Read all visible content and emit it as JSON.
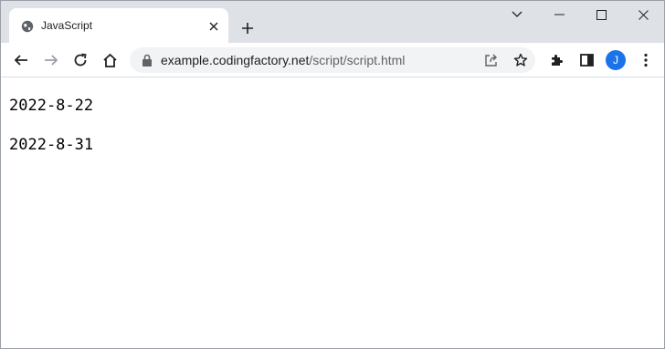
{
  "tab": {
    "title": "JavaScript"
  },
  "address_bar": {
    "domain": "example.codingfactory.net",
    "path": "/script/script.html"
  },
  "profile": {
    "initial": "J"
  },
  "page": {
    "lines": [
      "2022-8-22",
      "2022-8-31"
    ]
  }
}
